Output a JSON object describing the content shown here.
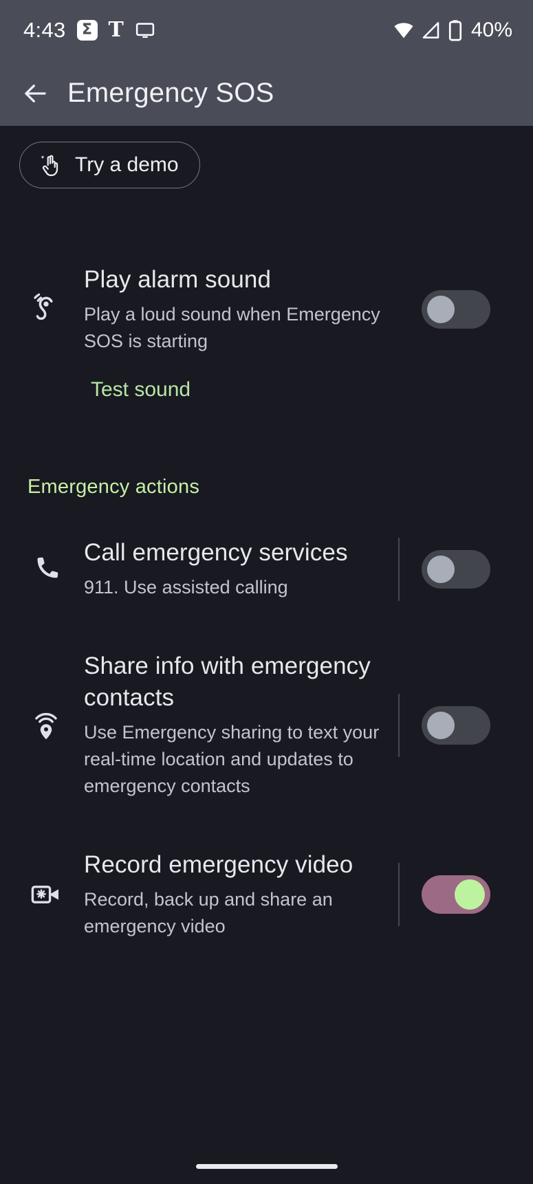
{
  "statusbar": {
    "time": "4:43",
    "sigma_icon": "sigma-app-icon",
    "sigma_glyph": "Σ",
    "nyt_icon": "nyt-app-icon",
    "nyt_glyph": "T",
    "cast_icon": "cast-screen-icon",
    "wifi_icon": "wifi-icon",
    "cellular_icon": "cellular-signal-icon",
    "battery_icon": "battery-icon",
    "battery_text": "40%"
  },
  "appbar": {
    "back_icon": "back-arrow-icon",
    "title": "Emergency SOS"
  },
  "demo": {
    "icon": "magic-hand-gesture-icon",
    "label": "Try a demo"
  },
  "alarm": {
    "icon": "hearing-sound-icon",
    "title": "Play alarm sound",
    "subtitle": "Play a loud sound when Emergency SOS is starting",
    "toggle_state": "off",
    "test_link": "Test sound"
  },
  "section": {
    "emergency_actions": "Emergency actions"
  },
  "actions": [
    {
      "icon": "phone-call-icon",
      "title": "Call emergency services",
      "subtitle": "911. Use assisted calling",
      "toggle_state": "off"
    },
    {
      "icon": "location-broadcast-pin-icon",
      "title": "Share info with emergency contacts",
      "subtitle": "Use Emergency sharing to text your real-time location and updates to emergency contacts",
      "toggle_state": "off"
    },
    {
      "icon": "emergency-video-camera-icon",
      "title": "Record emergency video",
      "subtitle": "Record, back up and share an emergency video",
      "toggle_state": "on"
    }
  ],
  "colors": {
    "statusbar_bg": "#4a4d58",
    "page_bg": "#191922",
    "accent_green": "#c5f0a4",
    "link_green": "#b8e6a5",
    "toggle_on_track": "#9c6a84",
    "toggle_on_knob": "#bdf39e",
    "toggle_off_track": "#43454d",
    "toggle_off_knob": "#a9adb7"
  },
  "nav": {
    "home_pill": "home-indicator"
  }
}
